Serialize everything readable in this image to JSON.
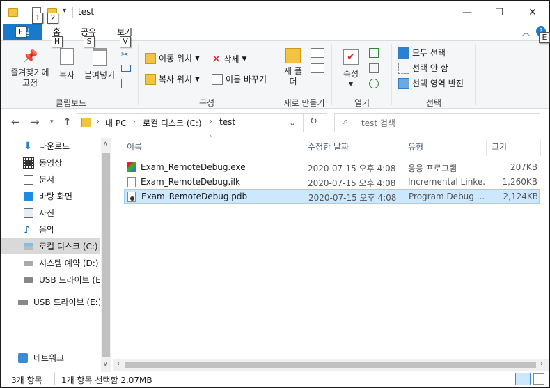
{
  "title": "test",
  "keytips": {
    "qat1": "1",
    "qat2": "2",
    "file": "F",
    "home": "H",
    "share": "S",
    "view": "V",
    "help": "E"
  },
  "tabs": {
    "file": "파일",
    "home": "홈",
    "share": "공유",
    "view": "보기"
  },
  "window_buttons": {
    "minimize": "—",
    "maximize": "☐",
    "close": "✕"
  },
  "ribbon": {
    "clipboard": {
      "pin": "즐겨찾기에 고정",
      "copy": "복사",
      "paste": "붙여넣기",
      "label": "클립보드"
    },
    "organize": {
      "move_to": "이동 위치",
      "copy_to": "복사 위치",
      "delete": "삭제",
      "rename": "이름 바꾸기",
      "label": "구성"
    },
    "new": {
      "new_folder": "새 폴더",
      "label": "새로 만들기"
    },
    "open": {
      "properties": "속성",
      "label": "열기"
    },
    "select": {
      "select_all": "모두 선택",
      "select_none": "선택 안 함",
      "invert": "선택 영역 반전",
      "label": "선택"
    }
  },
  "address": {
    "path": [
      "내 PC",
      "로컬 디스크 (C:)",
      "test"
    ],
    "search_placeholder": "test 검색"
  },
  "sidebar": {
    "items": [
      {
        "label": "다운로드",
        "icon": "download-arrow-icon"
      },
      {
        "label": "동영상",
        "icon": "film-icon"
      },
      {
        "label": "문서",
        "icon": "document-icon"
      },
      {
        "label": "바탕 화면",
        "icon": "desktop-icon"
      },
      {
        "label": "사진",
        "icon": "picture-icon"
      },
      {
        "label": "음악",
        "icon": "music-note-icon"
      },
      {
        "label": "로컬 디스크 (C:)",
        "icon": "local-disk-icon"
      },
      {
        "label": "시스템 예약 (D:)",
        "icon": "drive-icon"
      },
      {
        "label": "USB 드라이브 (E:)",
        "icon": "usb-drive-icon"
      },
      {
        "label": "USB 드라이브 (E:)",
        "icon": "usb-drive-icon"
      },
      {
        "label": "네트워크",
        "icon": "network-icon"
      }
    ]
  },
  "columns": {
    "name": "이름",
    "date": "수정한 날짜",
    "type": "유형",
    "size": "크기"
  },
  "files": [
    {
      "name": "Exam_RemoteDebug.exe",
      "date": "2020-07-15 오후 4:08",
      "type": "응용 프로그램",
      "size": "207KB",
      "icon": "exe-app-icon"
    },
    {
      "name": "Exam_RemoteDebug.ilk",
      "date": "2020-07-15 오후 4:08",
      "type": "Incremental Linke...",
      "size": "1,260KB",
      "icon": "file-icon"
    },
    {
      "name": "Exam_RemoteDebug.pdb",
      "date": "2020-07-15 오후 4:08",
      "type": "Program Debug ...",
      "size": "2,124KB",
      "icon": "pdb-file-icon"
    }
  ],
  "status": {
    "count": "3개 항목",
    "selection": "1개 항목 선택함 2.07MB"
  },
  "colors": {
    "accent": "#1979ca",
    "selection": "#cce8ff",
    "selection_border": "#99d1ff"
  }
}
